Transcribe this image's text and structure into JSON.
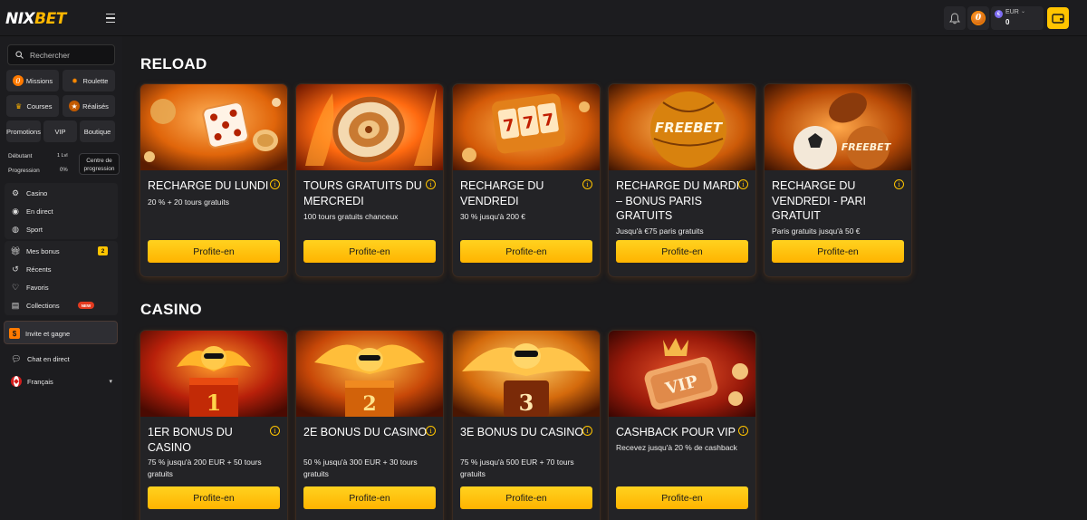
{
  "header": {
    "logo_main": "NIX",
    "logo_accent": "BET",
    "wallet_currency": "EUR",
    "wallet_amount": "0",
    "coin_letter": "0"
  },
  "sidebar": {
    "search_placeholder": "Rechercher",
    "tiles": [
      "Missions",
      "Roulette",
      "Courses",
      "Réalisés",
      "Promotions",
      "VIP",
      "Boutique"
    ],
    "progress": {
      "level_name": "Débutant",
      "level_value": "1 Lvl",
      "progress_label": "Progression",
      "progress_value": "0%",
      "center_button": "Centre de progression"
    },
    "nav_games": [
      "Casino",
      "En direct",
      "Sport"
    ],
    "nav_personal": [
      "Mes bonus",
      "Récents",
      "Favoris",
      "Collections"
    ],
    "mes_bonus_count": "2",
    "collections_badge": "NEW",
    "invite": "Invite et gagne",
    "chat": "Chat en direct",
    "language": "Français"
  },
  "sections": {
    "reload_title": "RELOAD",
    "casino_title": "CASINO"
  },
  "reload_cards": [
    {
      "title": "RECHARGE DU LUNDI",
      "desc": "20 % + 20 tours gratuits",
      "cta": "Profite-en"
    },
    {
      "title": "TOURS GRATUITS DU MERCREDI",
      "desc": "100 tours gratuits chanceux",
      "cta": "Profite-en"
    },
    {
      "title": "RECHARGE DU VENDREDI",
      "desc": "30 % jusqu'à 200 €",
      "cta": "Profite-en"
    },
    {
      "title": "RECHARGE DU MARDI – BONUS PARIS GRATUITS",
      "desc": "Jusqu'à €75 paris gratuits",
      "cta": "Profite-en",
      "image_text": "FREEBET"
    },
    {
      "title": "RECHARGE DU VENDREDI - PARI GRATUIT",
      "desc": "Paris gratuits jusqu'à 50 €",
      "cta": "Profite-en",
      "image_text": "FREEBET"
    }
  ],
  "casino_cards": [
    {
      "title": "1ER BONUS DU CASINO",
      "desc": "75 % jusqu'à 200 EUR + 50 tours gratuits",
      "cta": "Profite-en",
      "image_text": "1"
    },
    {
      "title": "2E BONUS DU CASINO",
      "desc": "50 % jusqu'à 300 EUR + 30 tours gratuits",
      "cta": "Profite-en",
      "image_text": "2"
    },
    {
      "title": "3E BONUS DU CASINO",
      "desc": "75 % jusqu'à 500 EUR + 70 tours gratuits",
      "cta": "Profite-en",
      "image_text": "3"
    },
    {
      "title": "CASHBACK POUR VIP",
      "desc": "Recevez jusqu'à 20 % de cashback",
      "cta": "Profite-en",
      "image_text": "VIP"
    }
  ],
  "colors": {
    "accent": "#ffc400",
    "cta_top": "#ffd21f",
    "cta_bottom": "#ffb400",
    "background": "#1b1b1d",
    "sidebar": "#1c1c1f"
  }
}
